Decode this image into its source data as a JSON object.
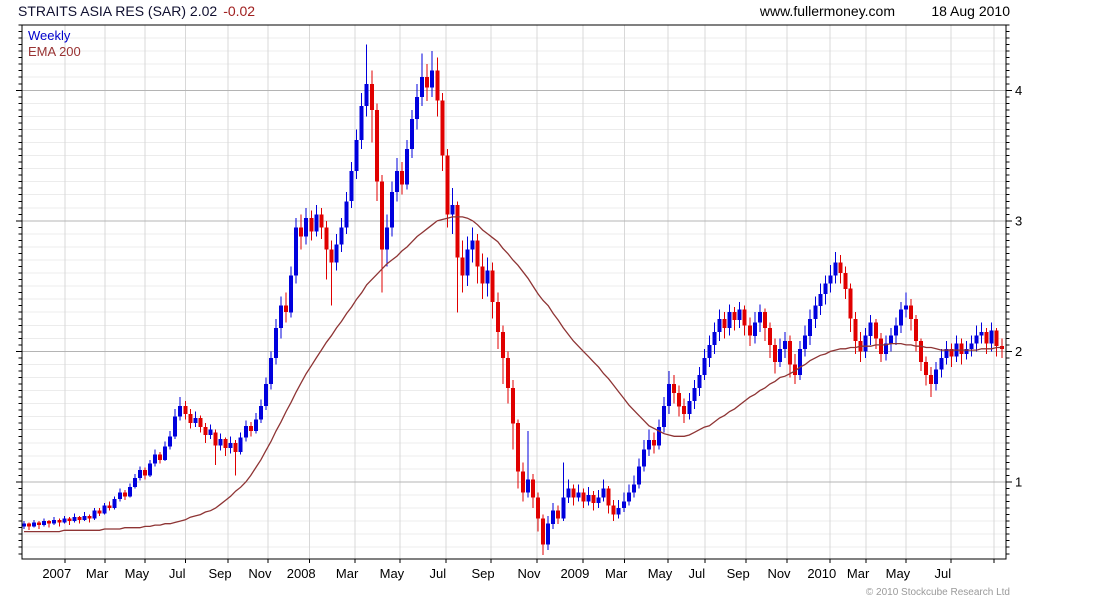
{
  "header": {
    "title_main": "STRAITS ASIA RES (SAR) 2.02",
    "title_change": "-0.02",
    "website": "www.fullermoney.com",
    "date": "18 Aug 2010"
  },
  "legend": {
    "timeframe": "Weekly",
    "indicator": "EMA 200"
  },
  "footer": {
    "copyright": "© 2010 Stockcube Research Ltd"
  },
  "colors": {
    "up": "#0000dd",
    "down": "#e00000",
    "ema": "#8e3434",
    "grid_major": "#b4b4b4",
    "grid_minor": "#ececec",
    "grid_vert": "#d8d8d8",
    "axis": "#000000",
    "tick_label": "#000000"
  },
  "chart_data": {
    "type": "candlestick",
    "title": "STRAITS ASIA RES (SAR) 2.02 -0.02, weekly candlesticks with EMA 200 overlay, Nov 2006 - Aug 2010",
    "legend_position": "top-left",
    "grid": true,
    "y_axis": {
      "min": 0.41,
      "max": 4.5,
      "major_ticks": [
        4,
        3,
        2,
        1
      ],
      "minor_tick_step": 0.05,
      "minor_grid_step": 0.1,
      "side": "right"
    },
    "x_axis": {
      "labels": [
        {
          "text": "2007",
          "week": 6.5
        },
        {
          "text": "Mar",
          "week": 14.5
        },
        {
          "text": "May",
          "week": 22.4
        },
        {
          "text": "Jul",
          "week": 30.4
        },
        {
          "text": "Sep",
          "week": 38.9
        },
        {
          "text": "Nov",
          "week": 46.8
        },
        {
          "text": "2008",
          "week": 55.0
        },
        {
          "text": "Mar",
          "week": 64.1
        },
        {
          "text": "May",
          "week": 73.0
        },
        {
          "text": "Jul",
          "week": 82.1
        },
        {
          "text": "Sep",
          "week": 91.1
        },
        {
          "text": "Nov",
          "week": 100.2
        },
        {
          "text": "2009",
          "week": 109.3
        },
        {
          "text": "Mar",
          "week": 117.5
        },
        {
          "text": "May",
          "week": 126.2
        },
        {
          "text": "Jul",
          "week": 133.5
        },
        {
          "text": "Sep",
          "week": 141.7
        },
        {
          "text": "Nov",
          "week": 149.8
        },
        {
          "text": "2010",
          "week": 158.3
        },
        {
          "text": "Mar",
          "week": 165.5
        },
        {
          "text": "May",
          "week": 173.4
        },
        {
          "text": "Jul",
          "week": 182.3
        }
      ],
      "grid_offset_weeks": 1.6,
      "extra_grid_weeks": [
        192.5
      ]
    },
    "series": [
      {
        "name": "Weekly candles",
        "type": "ohlc"
      },
      {
        "name": "EMA 200",
        "type": "line"
      }
    ],
    "candles": [
      [
        0.66,
        0.7,
        0.64,
        0.68
      ],
      [
        0.68,
        0.69,
        0.63,
        0.66
      ],
      [
        0.66,
        0.71,
        0.65,
        0.69
      ],
      [
        0.69,
        0.7,
        0.64,
        0.67
      ],
      [
        0.67,
        0.72,
        0.66,
        0.7
      ],
      [
        0.7,
        0.71,
        0.65,
        0.68
      ],
      [
        0.68,
        0.73,
        0.67,
        0.71
      ],
      [
        0.71,
        0.72,
        0.66,
        0.69
      ],
      [
        0.69,
        0.74,
        0.68,
        0.72
      ],
      [
        0.72,
        0.73,
        0.67,
        0.7
      ],
      [
        0.7,
        0.76,
        0.69,
        0.73
      ],
      [
        0.73,
        0.74,
        0.68,
        0.71
      ],
      [
        0.71,
        0.77,
        0.7,
        0.74
      ],
      [
        0.74,
        0.75,
        0.69,
        0.72
      ],
      [
        0.72,
        0.8,
        0.71,
        0.78
      ],
      [
        0.78,
        0.8,
        0.74,
        0.76
      ],
      [
        0.76,
        0.84,
        0.75,
        0.82
      ],
      [
        0.82,
        0.85,
        0.78,
        0.8
      ],
      [
        0.8,
        0.89,
        0.79,
        0.87
      ],
      [
        0.87,
        0.95,
        0.85,
        0.92
      ],
      [
        0.92,
        0.94,
        0.86,
        0.89
      ],
      [
        0.89,
        0.99,
        0.88,
        0.96
      ],
      [
        0.96,
        1.06,
        0.95,
        1.03
      ],
      [
        1.03,
        1.12,
        1.01,
        1.09
      ],
      [
        1.09,
        1.11,
        1.02,
        1.05
      ],
      [
        1.05,
        1.17,
        1.04,
        1.14
      ],
      [
        1.14,
        1.25,
        1.12,
        1.21
      ],
      [
        1.21,
        1.23,
        1.14,
        1.17
      ],
      [
        1.17,
        1.31,
        1.16,
        1.27
      ],
      [
        1.27,
        1.39,
        1.25,
        1.35
      ],
      [
        1.35,
        1.56,
        1.33,
        1.5
      ],
      [
        1.5,
        1.65,
        1.47,
        1.58
      ],
      [
        1.58,
        1.62,
        1.48,
        1.52
      ],
      [
        1.52,
        1.56,
        1.41,
        1.45
      ],
      [
        1.45,
        1.54,
        1.42,
        1.49
      ],
      [
        1.49,
        1.51,
        1.38,
        1.42
      ],
      [
        1.42,
        1.45,
        1.3,
        1.36
      ],
      [
        1.36,
        1.44,
        1.33,
        1.4
      ],
      [
        1.38,
        1.4,
        1.13,
        1.28
      ],
      [
        1.28,
        1.37,
        1.24,
        1.33
      ],
      [
        1.33,
        1.34,
        1.2,
        1.26
      ],
      [
        1.26,
        1.35,
        1.22,
        1.3
      ],
      [
        1.3,
        1.32,
        1.05,
        1.23
      ],
      [
        1.23,
        1.38,
        1.21,
        1.34
      ],
      [
        1.34,
        1.47,
        1.31,
        1.43
      ],
      [
        1.43,
        1.46,
        1.35,
        1.39
      ],
      [
        1.39,
        1.53,
        1.37,
        1.48
      ],
      [
        1.48,
        1.63,
        1.45,
        1.58
      ],
      [
        1.58,
        1.8,
        1.55,
        1.75
      ],
      [
        1.75,
        2.0,
        1.71,
        1.95
      ],
      [
        1.95,
        2.25,
        1.9,
        2.18
      ],
      [
        2.18,
        2.42,
        2.1,
        2.35
      ],
      [
        2.35,
        2.45,
        2.22,
        2.3
      ],
      [
        2.3,
        2.65,
        2.26,
        2.58
      ],
      [
        2.58,
        3.02,
        2.52,
        2.95
      ],
      [
        2.95,
        3.05,
        2.78,
        2.88
      ],
      [
        2.88,
        3.1,
        2.82,
        3.02
      ],
      [
        3.02,
        3.08,
        2.85,
        2.92
      ],
      [
        2.92,
        3.12,
        2.88,
        3.05
      ],
      [
        3.05,
        3.1,
        2.86,
        2.95
      ],
      [
        2.95,
        3.0,
        2.55,
        2.78
      ],
      [
        2.78,
        2.85,
        2.35,
        2.68
      ],
      [
        2.68,
        2.9,
        2.62,
        2.82
      ],
      [
        2.82,
        3.02,
        2.76,
        2.95
      ],
      [
        2.95,
        3.22,
        2.9,
        3.15
      ],
      [
        3.15,
        3.45,
        3.1,
        3.38
      ],
      [
        3.38,
        3.7,
        3.32,
        3.62
      ],
      [
        3.62,
        3.98,
        3.55,
        3.88
      ],
      [
        3.88,
        4.35,
        3.8,
        4.05
      ],
      [
        4.05,
        4.15,
        3.6,
        3.85
      ],
      [
        3.85,
        3.9,
        3.15,
        3.3
      ],
      [
        3.3,
        3.35,
        2.45,
        2.78
      ],
      [
        2.78,
        3.05,
        2.65,
        2.95
      ],
      [
        2.95,
        3.3,
        2.88,
        3.22
      ],
      [
        3.22,
        3.48,
        3.15,
        3.38
      ],
      [
        3.38,
        3.45,
        3.2,
        3.28
      ],
      [
        3.28,
        3.62,
        3.24,
        3.55
      ],
      [
        3.55,
        3.85,
        3.48,
        3.78
      ],
      [
        3.78,
        4.05,
        3.7,
        3.95
      ],
      [
        3.95,
        4.28,
        3.88,
        4.1
      ],
      [
        4.1,
        4.2,
        3.92,
        4.02
      ],
      [
        4.02,
        4.3,
        3.95,
        4.15
      ],
      [
        4.15,
        4.25,
        3.8,
        3.92
      ],
      [
        3.92,
        3.98,
        3.38,
        3.5
      ],
      [
        3.5,
        3.55,
        2.95,
        3.05
      ],
      [
        3.05,
        3.25,
        2.9,
        3.12
      ],
      [
        3.12,
        3.15,
        2.3,
        2.72
      ],
      [
        2.72,
        2.85,
        2.45,
        2.58
      ],
      [
        2.58,
        2.88,
        2.5,
        2.78
      ],
      [
        2.78,
        2.95,
        2.68,
        2.85
      ],
      [
        2.85,
        2.9,
        2.52,
        2.65
      ],
      [
        2.65,
        2.75,
        2.4,
        2.52
      ],
      [
        2.52,
        2.72,
        2.42,
        2.62
      ],
      [
        2.62,
        2.68,
        2.25,
        2.38
      ],
      [
        2.38,
        2.45,
        2.02,
        2.15
      ],
      [
        2.15,
        2.2,
        1.75,
        1.95
      ],
      [
        1.95,
        2.0,
        1.6,
        1.72
      ],
      [
        1.72,
        1.78,
        1.25,
        1.45
      ],
      [
        1.45,
        1.48,
        0.95,
        1.08
      ],
      [
        1.08,
        1.15,
        0.85,
        0.92
      ],
      [
        0.92,
        1.39,
        0.88,
        1.02
      ],
      [
        1.02,
        1.06,
        0.8,
        0.88
      ],
      [
        0.88,
        0.92,
        0.62,
        0.72
      ],
      [
        0.72,
        0.75,
        0.44,
        0.52
      ],
      [
        0.52,
        0.74,
        0.48,
        0.68
      ],
      [
        0.68,
        0.84,
        0.64,
        0.78
      ],
      [
        0.78,
        0.82,
        0.68,
        0.72
      ],
      [
        0.72,
        1.15,
        0.7,
        0.88
      ],
      [
        0.88,
        1.02,
        0.84,
        0.95
      ],
      [
        0.95,
        0.98,
        0.82,
        0.88
      ],
      [
        0.88,
        0.98,
        0.85,
        0.92
      ],
      [
        0.92,
        0.95,
        0.8,
        0.85
      ],
      [
        0.85,
        0.96,
        0.82,
        0.9
      ],
      [
        0.9,
        0.93,
        0.78,
        0.84
      ],
      [
        0.84,
        0.94,
        0.8,
        0.88
      ],
      [
        0.88,
        1.02,
        0.85,
        0.95
      ],
      [
        0.95,
        0.97,
        0.76,
        0.82
      ],
      [
        0.82,
        0.86,
        0.7,
        0.75
      ],
      [
        0.75,
        0.86,
        0.72,
        0.8
      ],
      [
        0.8,
        0.92,
        0.77,
        0.85
      ],
      [
        0.85,
        0.98,
        0.82,
        0.92
      ],
      [
        0.92,
        1.05,
        0.88,
        0.98
      ],
      [
        0.98,
        1.18,
        0.95,
        1.12
      ],
      [
        1.12,
        1.32,
        1.08,
        1.25
      ],
      [
        1.25,
        1.4,
        1.2,
        1.32
      ],
      [
        1.32,
        1.38,
        1.22,
        1.28
      ],
      [
        1.28,
        1.48,
        1.25,
        1.42
      ],
      [
        1.42,
        1.65,
        1.38,
        1.58
      ],
      [
        1.58,
        1.85,
        1.52,
        1.75
      ],
      [
        1.75,
        1.82,
        1.6,
        1.68
      ],
      [
        1.68,
        1.74,
        1.5,
        1.58
      ],
      [
        1.58,
        1.64,
        1.45,
        1.52
      ],
      [
        1.52,
        1.68,
        1.48,
        1.62
      ],
      [
        1.62,
        1.78,
        1.56,
        1.72
      ],
      [
        1.72,
        1.88,
        1.66,
        1.82
      ],
      [
        1.82,
        2.02,
        1.78,
        1.95
      ],
      [
        1.95,
        2.12,
        1.88,
        2.05
      ],
      [
        2.05,
        2.22,
        1.98,
        2.15
      ],
      [
        2.15,
        2.32,
        2.08,
        2.25
      ],
      [
        2.25,
        2.3,
        2.1,
        2.18
      ],
      [
        2.18,
        2.36,
        2.12,
        2.3
      ],
      [
        2.3,
        2.34,
        2.16,
        2.24
      ],
      [
        2.24,
        2.38,
        2.18,
        2.32
      ],
      [
        2.32,
        2.35,
        2.12,
        2.2
      ],
      [
        2.2,
        2.26,
        2.04,
        2.12
      ],
      [
        2.12,
        2.3,
        2.06,
        2.22
      ],
      [
        2.22,
        2.36,
        2.15,
        2.3
      ],
      [
        2.3,
        2.33,
        2.08,
        2.18
      ],
      [
        2.18,
        2.22,
        1.95,
        2.05
      ],
      [
        2.05,
        2.1,
        1.83,
        1.92
      ],
      [
        1.92,
        2.1,
        1.88,
        2.02
      ],
      [
        2.02,
        2.15,
        1.95,
        2.08
      ],
      [
        2.08,
        2.12,
        1.8,
        1.9
      ],
      [
        1.9,
        1.98,
        1.75,
        1.82
      ],
      [
        1.82,
        2.08,
        1.78,
        2.02
      ],
      [
        2.02,
        2.2,
        1.96,
        2.12
      ],
      [
        2.12,
        2.32,
        2.05,
        2.25
      ],
      [
        2.25,
        2.42,
        2.18,
        2.35
      ],
      [
        2.35,
        2.52,
        2.28,
        2.44
      ],
      [
        2.44,
        2.58,
        2.36,
        2.52
      ],
      [
        2.52,
        2.66,
        2.45,
        2.58
      ],
      [
        2.58,
        2.76,
        2.52,
        2.68
      ],
      [
        2.68,
        2.74,
        2.52,
        2.6
      ],
      [
        2.6,
        2.65,
        2.4,
        2.48
      ],
      [
        2.48,
        2.52,
        2.15,
        2.25
      ],
      [
        2.25,
        2.3,
        1.98,
        2.08
      ],
      [
        2.08,
        2.15,
        1.92,
        2.0
      ],
      [
        2.0,
        2.18,
        1.95,
        2.12
      ],
      [
        2.12,
        2.28,
        2.05,
        2.22
      ],
      [
        2.22,
        2.25,
        2.02,
        2.1
      ],
      [
        2.1,
        2.14,
        1.92,
        1.98
      ],
      [
        1.98,
        2.12,
        1.93,
        2.06
      ],
      [
        2.06,
        2.18,
        2.0,
        2.12
      ],
      [
        2.12,
        2.26,
        2.05,
        2.2
      ],
      [
        2.2,
        2.38,
        2.14,
        2.32
      ],
      [
        2.32,
        2.45,
        2.26,
        2.35
      ],
      [
        2.35,
        2.4,
        2.16,
        2.25
      ],
      [
        2.25,
        2.28,
        2.0,
        2.08
      ],
      [
        2.08,
        2.1,
        1.85,
        1.92
      ],
      [
        1.92,
        1.96,
        1.74,
        1.82
      ],
      [
        1.82,
        1.88,
        1.65,
        1.75
      ],
      [
        1.75,
        1.92,
        1.7,
        1.86
      ],
      [
        1.86,
        2.02,
        1.8,
        1.95
      ],
      [
        1.95,
        2.08,
        1.9,
        2.02
      ],
      [
        2.02,
        2.06,
        1.88,
        1.96
      ],
      [
        1.96,
        2.12,
        1.92,
        2.06
      ],
      [
        2.06,
        2.1,
        1.9,
        1.98
      ],
      [
        1.98,
        2.08,
        1.94,
        2.02
      ],
      [
        2.02,
        2.12,
        1.96,
        2.06
      ],
      [
        2.06,
        2.2,
        2.0,
        2.12
      ],
      [
        2.12,
        2.22,
        2.06,
        2.15
      ],
      [
        2.15,
        2.18,
        1.98,
        2.06
      ],
      [
        2.06,
        2.22,
        2.0,
        2.16
      ],
      [
        2.16,
        2.18,
        1.96,
        2.04
      ],
      [
        2.04,
        2.1,
        1.95,
        2.02
      ]
    ],
    "ema": [
      0.62,
      0.62,
      0.62,
      0.62,
      0.62,
      0.62,
      0.62,
      0.62,
      0.63,
      0.63,
      0.63,
      0.63,
      0.63,
      0.63,
      0.63,
      0.63,
      0.64,
      0.64,
      0.64,
      0.64,
      0.65,
      0.65,
      0.65,
      0.65,
      0.66,
      0.66,
      0.67,
      0.67,
      0.68,
      0.68,
      0.69,
      0.7,
      0.71,
      0.73,
      0.74,
      0.75,
      0.77,
      0.78,
      0.8,
      0.83,
      0.86,
      0.89,
      0.93,
      0.96,
      1.0,
      1.05,
      1.11,
      1.17,
      1.24,
      1.31,
      1.39,
      1.46,
      1.54,
      1.61,
      1.69,
      1.76,
      1.83,
      1.89,
      1.95,
      2.01,
      2.07,
      2.12,
      2.18,
      2.23,
      2.29,
      2.34,
      2.4,
      2.45,
      2.51,
      2.55,
      2.59,
      2.63,
      2.67,
      2.7,
      2.73,
      2.77,
      2.8,
      2.84,
      2.88,
      2.91,
      2.94,
      2.97,
      3.0,
      3.01,
      3.02,
      3.03,
      3.03,
      3.03,
      3.02,
      3.0,
      2.97,
      2.93,
      2.9,
      2.87,
      2.84,
      2.79,
      2.75,
      2.7,
      2.66,
      2.61,
      2.56,
      2.5,
      2.44,
      2.39,
      2.35,
      2.29,
      2.24,
      2.18,
      2.13,
      2.08,
      2.04,
      2.0,
      1.96,
      1.92,
      1.88,
      1.83,
      1.79,
      1.74,
      1.69,
      1.64,
      1.59,
      1.55,
      1.51,
      1.47,
      1.43,
      1.41,
      1.39,
      1.37,
      1.36,
      1.35,
      1.35,
      1.35,
      1.36,
      1.38,
      1.4,
      1.42,
      1.43,
      1.46,
      1.49,
      1.51,
      1.54,
      1.56,
      1.59,
      1.62,
      1.65,
      1.67,
      1.7,
      1.72,
      1.75,
      1.77,
      1.8,
      1.81,
      1.83,
      1.85,
      1.88,
      1.9,
      1.93,
      1.95,
      1.97,
      1.98,
      2.0,
      2.01,
      2.02,
      2.02,
      2.03,
      2.03,
      2.04,
      2.04,
      2.04,
      2.05,
      2.05,
      2.05,
      2.06,
      2.06,
      2.06,
      2.05,
      2.05,
      2.04,
      2.04,
      2.03,
      2.03,
      2.02,
      2.01,
      2.01,
      2.01,
      2.01,
      2.01,
      2.01,
      2.01,
      2.01,
      2.02,
      2.02,
      2.02,
      2.03,
      2.03
    ]
  }
}
